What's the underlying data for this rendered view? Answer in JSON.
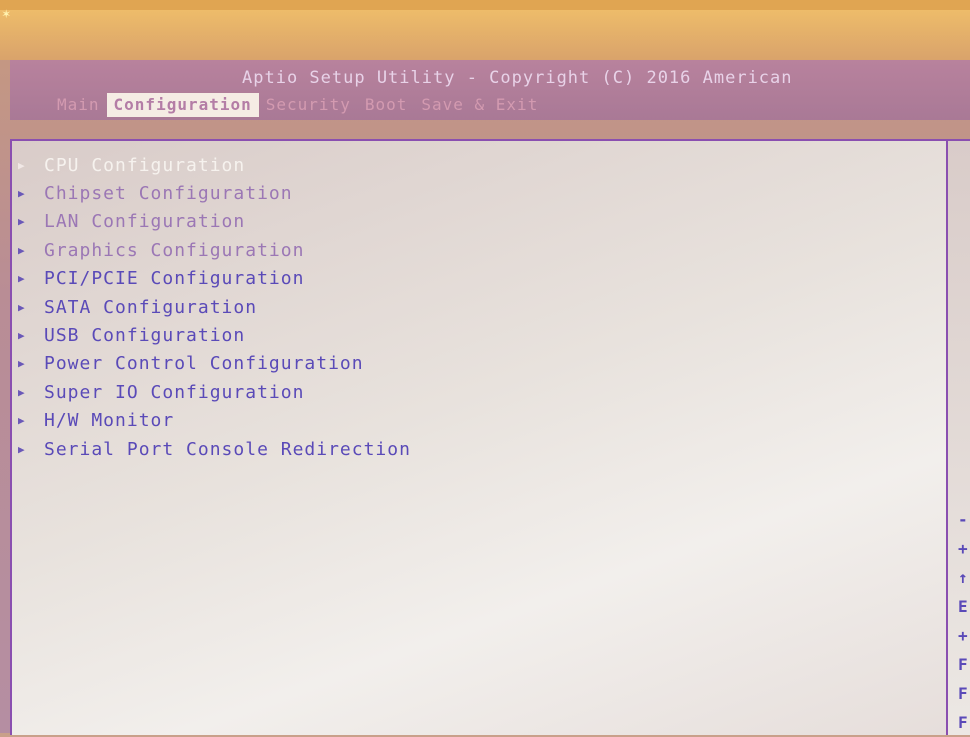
{
  "header": {
    "title": "Aptio Setup Utility - Copyright (C) 2016 American"
  },
  "tabs": [
    {
      "label": "Main",
      "active": false
    },
    {
      "label": "Configuration",
      "active": true
    },
    {
      "label": "Security",
      "active": false
    },
    {
      "label": "Boot",
      "active": false
    },
    {
      "label": "Save & Exit",
      "active": false
    }
  ],
  "menu": {
    "items": [
      {
        "label": "CPU Configuration",
        "selected": true
      },
      {
        "label": "Chipset Configuration"
      },
      {
        "label": "LAN Configuration"
      },
      {
        "label": "Graphics Configuration"
      },
      {
        "label": "PCI/PCIE Configuration"
      },
      {
        "label": "SATA Configuration"
      },
      {
        "label": "USB Configuration"
      },
      {
        "label": "Power Control Configuration"
      },
      {
        "label": "Super IO Configuration"
      },
      {
        "label": "H/W Monitor"
      },
      {
        "label": "Serial Port Console Redirection"
      }
    ]
  },
  "help": {
    "keys": [
      "-",
      "+",
      "↑",
      "E",
      "+",
      "F",
      "F",
      "F"
    ]
  },
  "colors": {
    "accent": "#8a4fb0",
    "menu_text": "#5a4ab8",
    "selected_text": "#f6f2ee",
    "tab_active_bg": "#f5ece4"
  }
}
